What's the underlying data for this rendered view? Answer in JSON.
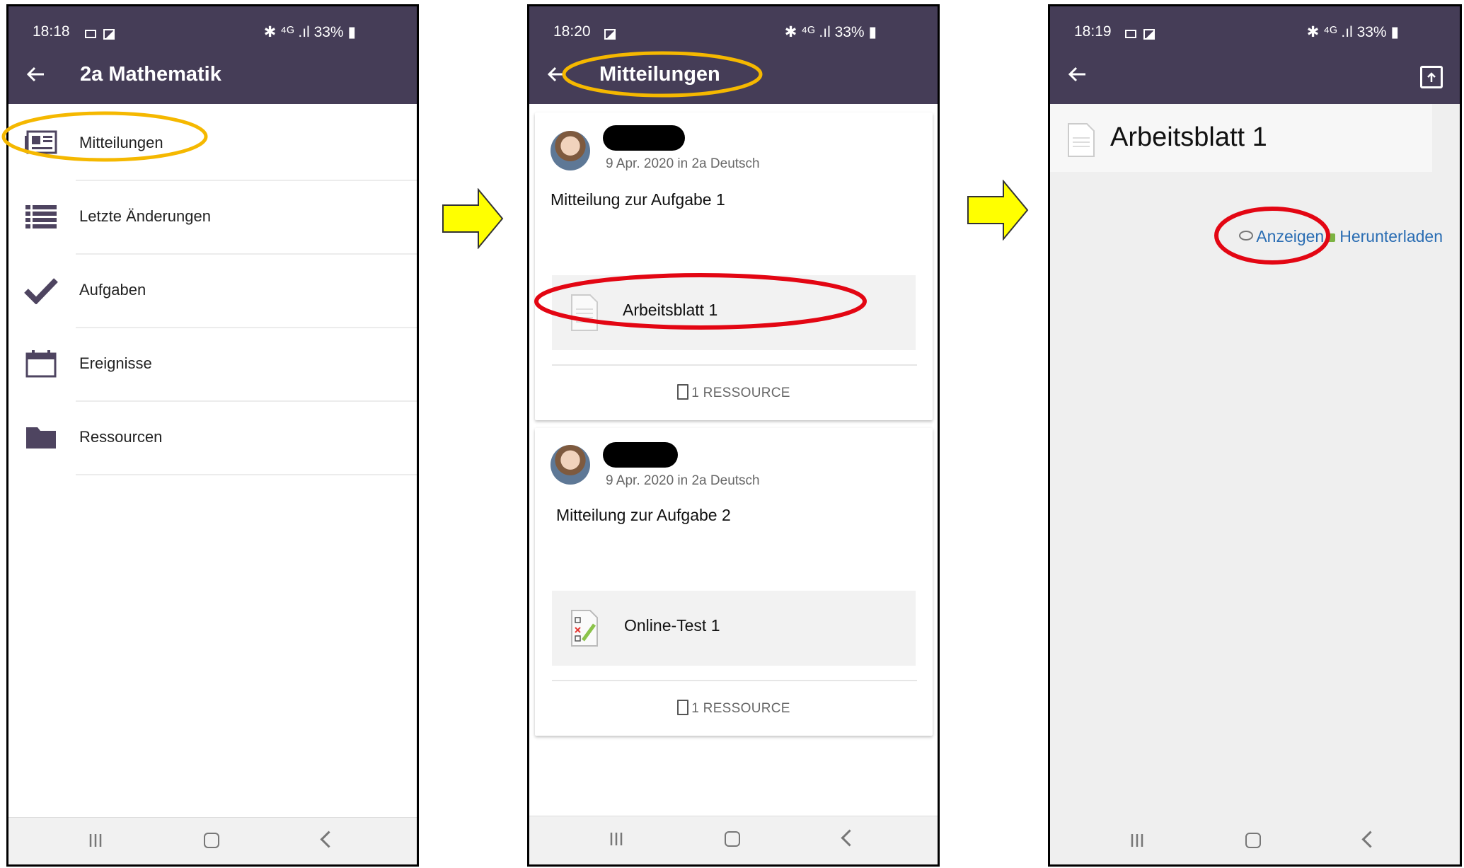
{
  "panel1": {
    "status": {
      "time": "18:18",
      "battery": "33%"
    },
    "header": {
      "title": "2a Mathematik"
    },
    "menu": [
      {
        "label": "Mitteilungen",
        "icon": "newspaper-icon"
      },
      {
        "label": "Letzte Änderungen",
        "icon": "list-icon"
      },
      {
        "label": "Aufgaben",
        "icon": "checkmark-icon"
      },
      {
        "label": "Ereignisse",
        "icon": "calendar-icon"
      },
      {
        "label": "Ressourcen",
        "icon": "folder-icon"
      }
    ]
  },
  "panel2": {
    "status": {
      "time": "18:20",
      "battery": "33%"
    },
    "header": {
      "title": "Mitteilungen"
    },
    "posts": [
      {
        "meta": "9 Apr. 2020 in 2a Deutsch",
        "message": "Mitteilung zur Aufgabe 1",
        "attachment": "Arbeitsblatt 1",
        "attachment_icon": "document-icon",
        "resources": "1 RESSOURCE"
      },
      {
        "meta": "9 Apr. 2020 in 2a Deutsch",
        "message": "Mitteilung zur Aufgabe 2",
        "attachment": "Online-Test 1",
        "attachment_icon": "quiz-icon",
        "resources": "1 RESSOURCE"
      }
    ]
  },
  "panel3": {
    "status": {
      "time": "18:19",
      "battery": "33%"
    },
    "document_title": "Arbeitsblatt 1",
    "view_label": "Anzeigen",
    "download_label": "Herunterladen"
  },
  "colors": {
    "header": "#453d57",
    "highlight_orange": "#f5b800",
    "highlight_red": "#e30613",
    "arrow_yellow": "#ffff00",
    "link": "#2a6db3"
  }
}
